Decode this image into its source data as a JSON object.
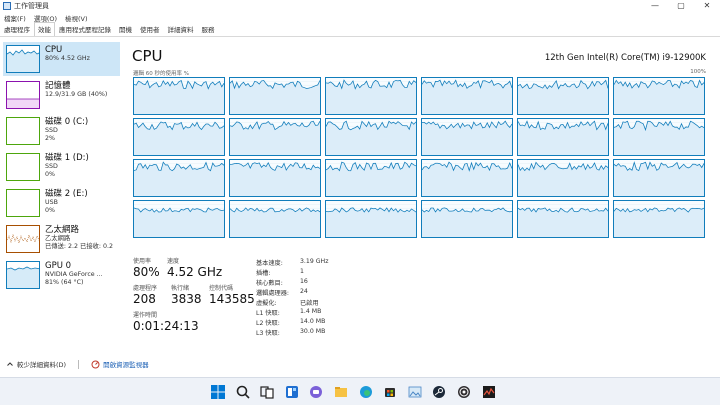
{
  "window": {
    "title": "工作管理員"
  },
  "menu": [
    "檔案(F)",
    "選項(O)",
    "檢視(V)"
  ],
  "tabs": [
    "處理程序",
    "效能",
    "應用程式歷程記錄",
    "開機",
    "使用者",
    "詳細資料",
    "服務"
  ],
  "active_tab": "效能",
  "sidebar": [
    {
      "title": "CPU",
      "sub1": "80% 4.52 GHz",
      "sub2": "",
      "sub3": "",
      "color": "#117dbb"
    },
    {
      "title": "記憶體",
      "sub1": "12.9/31.9 GB (40%)",
      "sub2": "",
      "sub3": "",
      "color": "#8b12ae"
    },
    {
      "title": "磁碟 0 (C:)",
      "sub1": "SSD",
      "sub2": "2%",
      "sub3": "",
      "color": "#4da60c"
    },
    {
      "title": "磁碟 1 (D:)",
      "sub1": "SSD",
      "sub2": "0%",
      "sub3": "",
      "color": "#4da60c"
    },
    {
      "title": "磁碟 2 (E:)",
      "sub1": "USB",
      "sub2": "0%",
      "sub3": "",
      "color": "#4da60c"
    },
    {
      "title": "乙太網路",
      "sub1": "乙太網路",
      "sub2": "已傳送: 2.2  已接收: 0.2",
      "sub3": "",
      "color": "#a74f01"
    },
    {
      "title": "GPU 0",
      "sub1": "NVIDIA GeForce ...",
      "sub2": "81% (64 °C)",
      "sub3": "",
      "color": "#117dbb"
    }
  ],
  "main": {
    "title": "CPU",
    "model": "12th Gen Intel(R) Core(TM) i9-12900K",
    "util_caption": "邏輯 60 秒的使用率 %",
    "util_max": "100%"
  },
  "stats": {
    "utilization_label": "使用率",
    "utilization": "80%",
    "speed_label": "速度",
    "speed": "4.52 GHz",
    "processes_label": "處理程序",
    "processes": "208",
    "threads_label": "執行緒",
    "threads": "3838",
    "handles_label": "控制代碼",
    "handles": "143585",
    "uptime_label": "運作時間",
    "uptime": "0:01:24:13"
  },
  "details": [
    {
      "k": "基本速度:",
      "v": "3.19 GHz"
    },
    {
      "k": "插槽:",
      "v": "1"
    },
    {
      "k": "核心數目:",
      "v": "16"
    },
    {
      "k": "邏輯處理器:",
      "v": "24"
    },
    {
      "k": "虛擬化:",
      "v": "已啟用"
    },
    {
      "k": "L1 快取:",
      "v": "1.4 MB"
    },
    {
      "k": "L2 快取:",
      "v": "14.0 MB"
    },
    {
      "k": "L3 快取:",
      "v": "30.0 MB"
    }
  ],
  "footer": {
    "fewer_details": "較少詳細資料(D)",
    "open_monitor": "開啟資源監視器"
  },
  "taskbar_icons": [
    "windows-start-icon",
    "search-icon",
    "task-view-icon",
    "widgets-icon",
    "chat-icon",
    "file-explorer-icon",
    "edge-icon",
    "store-icon",
    "photos-icon",
    "steam-icon",
    "obs-icon",
    "task-manager-icon"
  ],
  "colors": {
    "accent": "#117dbb",
    "selected": "#cde6f7"
  }
}
